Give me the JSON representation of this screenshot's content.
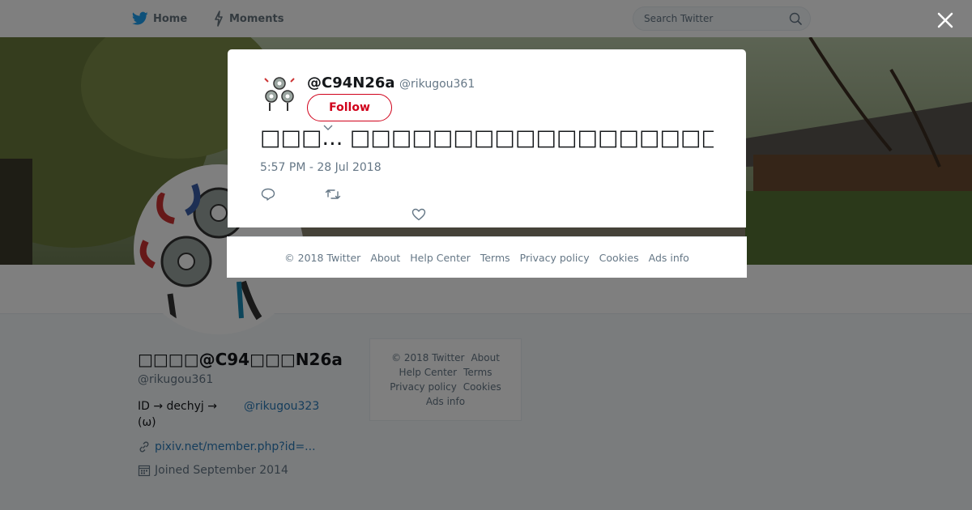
{
  "nav": {
    "home_label": "Home",
    "moments_label": "Moments",
    "search_placeholder": "Search Twitter",
    "brand_color": "#1da1f2"
  },
  "profile": {
    "display_name": "□□□□@C94□□□N26a",
    "handle": "@rikugou361",
    "bio_text": "ID → dechyj  →",
    "bio_suffix": "(ω)",
    "bio_mention": "@rikugou323",
    "link_text": "pixiv.net/member.php?id=...",
    "joined": "Joined September 2014"
  },
  "side_footer": {
    "row1": [
      "© 2018 Twitter",
      "About"
    ],
    "row2": [
      "Help Center",
      "Terms"
    ],
    "row3": [
      "Privacy policy",
      "Cookies"
    ],
    "row4": [
      "Ads info"
    ]
  },
  "tweet": {
    "name": "@C94N26a",
    "handle": "@rikugou361",
    "follow_label": "Follow",
    "text": "□□□... □□□□□□□□□□□□□□□□□□□□□□□□...",
    "timestamp": "5:57 PM - 28 Jul 2018",
    "accent_color": "#d0021b"
  },
  "modal_footer": {
    "copyright": "© 2018 Twitter",
    "about": "About",
    "help": "Help Center",
    "terms": "Terms",
    "privacy": "Privacy policy",
    "cookies": "Cookies",
    "ads": "Ads info"
  },
  "icons": {
    "close": "close-icon",
    "reply": "reply-icon",
    "retweet": "retweet-icon",
    "like": "heart-icon"
  }
}
